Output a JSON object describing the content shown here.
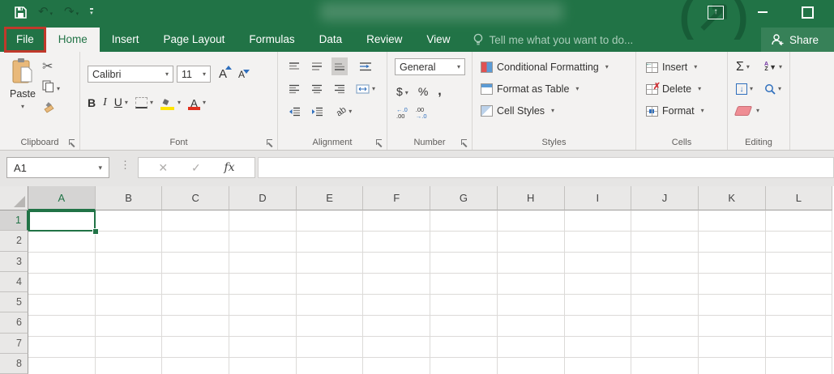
{
  "colors": {
    "excel_green": "#217346",
    "active_tab_text": "#217346",
    "annotation_red": "#c0392b",
    "selection_green": "#217346",
    "accent_blue": "#2f6fbd",
    "fill_yellow": "#ffe400",
    "font_color_red": "#e0301e",
    "eraser_pink": "#ef8d94"
  },
  "tabs": [
    "File",
    "Home",
    "Insert",
    "Page Layout",
    "Formulas",
    "Data",
    "Review",
    "View"
  ],
  "active_tab": "Home",
  "tell_me": "Tell me what you want to do...",
  "share_label": "Share",
  "ribbon": {
    "clipboard": {
      "label": "Clipboard",
      "paste_label": "Paste"
    },
    "font": {
      "label": "Font",
      "font_name": "Calibri",
      "font_size": "11",
      "bold": "B",
      "italic": "I",
      "underline": "U"
    },
    "alignment": {
      "label": "Alignment",
      "orientation": "ab"
    },
    "number": {
      "label": "Number",
      "format": "General",
      "currency": "$",
      "percent": "%",
      "comma": ",",
      "inc_top": "←.0",
      "inc_bottom": ".00",
      "dec_top": ".00",
      "dec_bottom": "→.0"
    },
    "styles": {
      "label": "Styles",
      "items": [
        "Conditional Formatting",
        "Format as Table",
        "Cell Styles"
      ]
    },
    "cells": {
      "label": "Cells",
      "items": [
        "Insert",
        "Delete",
        "Format"
      ]
    },
    "editing": {
      "label": "Editing",
      "autosum": "Σ",
      "sort_a": "A",
      "sort_z": "Z",
      "fill_arrow": "↓"
    }
  },
  "formula_bar": {
    "name_box": "A1",
    "fx_label": "fx"
  },
  "grid": {
    "columns": [
      "A",
      "B",
      "C",
      "D",
      "E",
      "F",
      "G",
      "H",
      "I",
      "J",
      "K",
      "L"
    ],
    "rows": [
      "1",
      "2",
      "3",
      "4",
      "5",
      "6",
      "7",
      "8"
    ],
    "selected_cell": "A1",
    "selected_column": "A",
    "selected_row": "1"
  }
}
